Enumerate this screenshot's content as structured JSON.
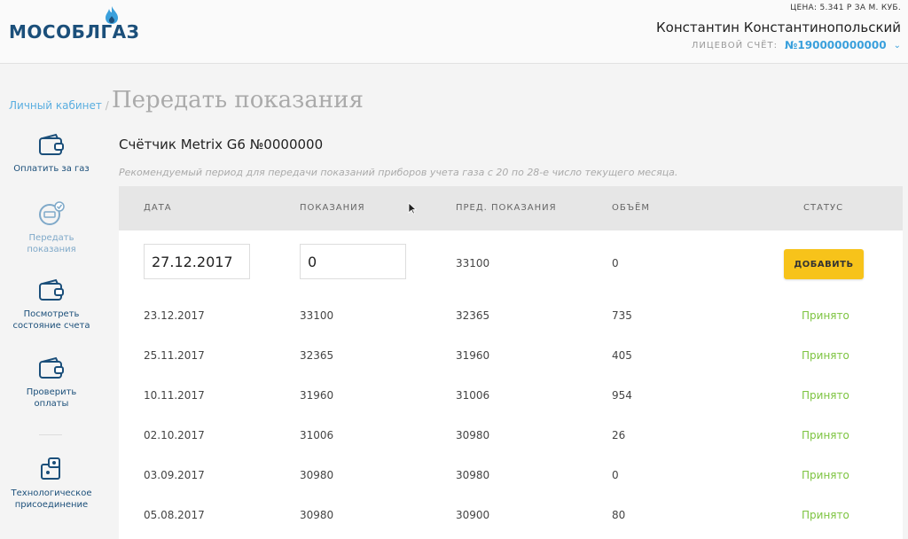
{
  "header": {
    "logo_text": "МОСОБЛГАЗ",
    "price_text": "ЦЕНА: 5.341 Р ЗА М. КУБ.",
    "user_name": "Константин Константинопольский",
    "account_label": "ЛИЦЕВОЙ СЧЁТ:",
    "account_number": "№190000000000"
  },
  "breadcrumb": {
    "link": "Личный кабинет",
    "separator": "/"
  },
  "page_title": "Передать показания",
  "sidebar": {
    "items": [
      {
        "label": "Оплатить за газ",
        "icon": "wallet-icon",
        "active": false
      },
      {
        "label": "Передать показания",
        "icon": "meter-icon",
        "active": true
      },
      {
        "label": "Посмотреть состояние счета",
        "icon": "wallet-icon",
        "active": false
      },
      {
        "label": "Проверить оплаты",
        "icon": "wallet-icon",
        "active": false
      },
      {
        "label": "Технологическое присоединение",
        "icon": "connection-icon",
        "active": false
      }
    ]
  },
  "meter": {
    "title": "Счётчик Metrix G6 №0000000",
    "hint": "Рекомендуемый период для передачи показаний приборов учета газа с 20 по 28-е число текущего месяца."
  },
  "table": {
    "headers": [
      "ДАТА",
      "ПОКАЗАНИЯ",
      "ПРЕД. ПОКАЗАНИЯ",
      "ОБЪЁМ",
      "СТАТУС"
    ],
    "input_row": {
      "date_value": "27.12.2017",
      "reading_value": "0",
      "prev_reading": "33100",
      "volume": "0",
      "add_button": "ДОБАВИТЬ"
    },
    "rows": [
      {
        "date": "23.12.2017",
        "reading": "33100",
        "prev": "32365",
        "volume": "735",
        "status": "Принято"
      },
      {
        "date": "25.11.2017",
        "reading": "32365",
        "prev": "31960",
        "volume": "405",
        "status": "Принято"
      },
      {
        "date": "10.11.2017",
        "reading": "31960",
        "prev": "31006",
        "volume": "954",
        "status": "Принято"
      },
      {
        "date": "02.10.2017",
        "reading": "31006",
        "prev": "30980",
        "volume": "26",
        "status": "Принято"
      },
      {
        "date": "03.09.2017",
        "reading": "30980",
        "prev": "30980",
        "volume": "0",
        "status": "Принято"
      },
      {
        "date": "05.08.2017",
        "reading": "30980",
        "prev": "30900",
        "volume": "80",
        "status": "Принято"
      }
    ]
  },
  "colors": {
    "brand": "#1b4f7a",
    "link": "#3aa0dc",
    "accepted": "#7dc440",
    "add_button": "#f7c31a"
  }
}
